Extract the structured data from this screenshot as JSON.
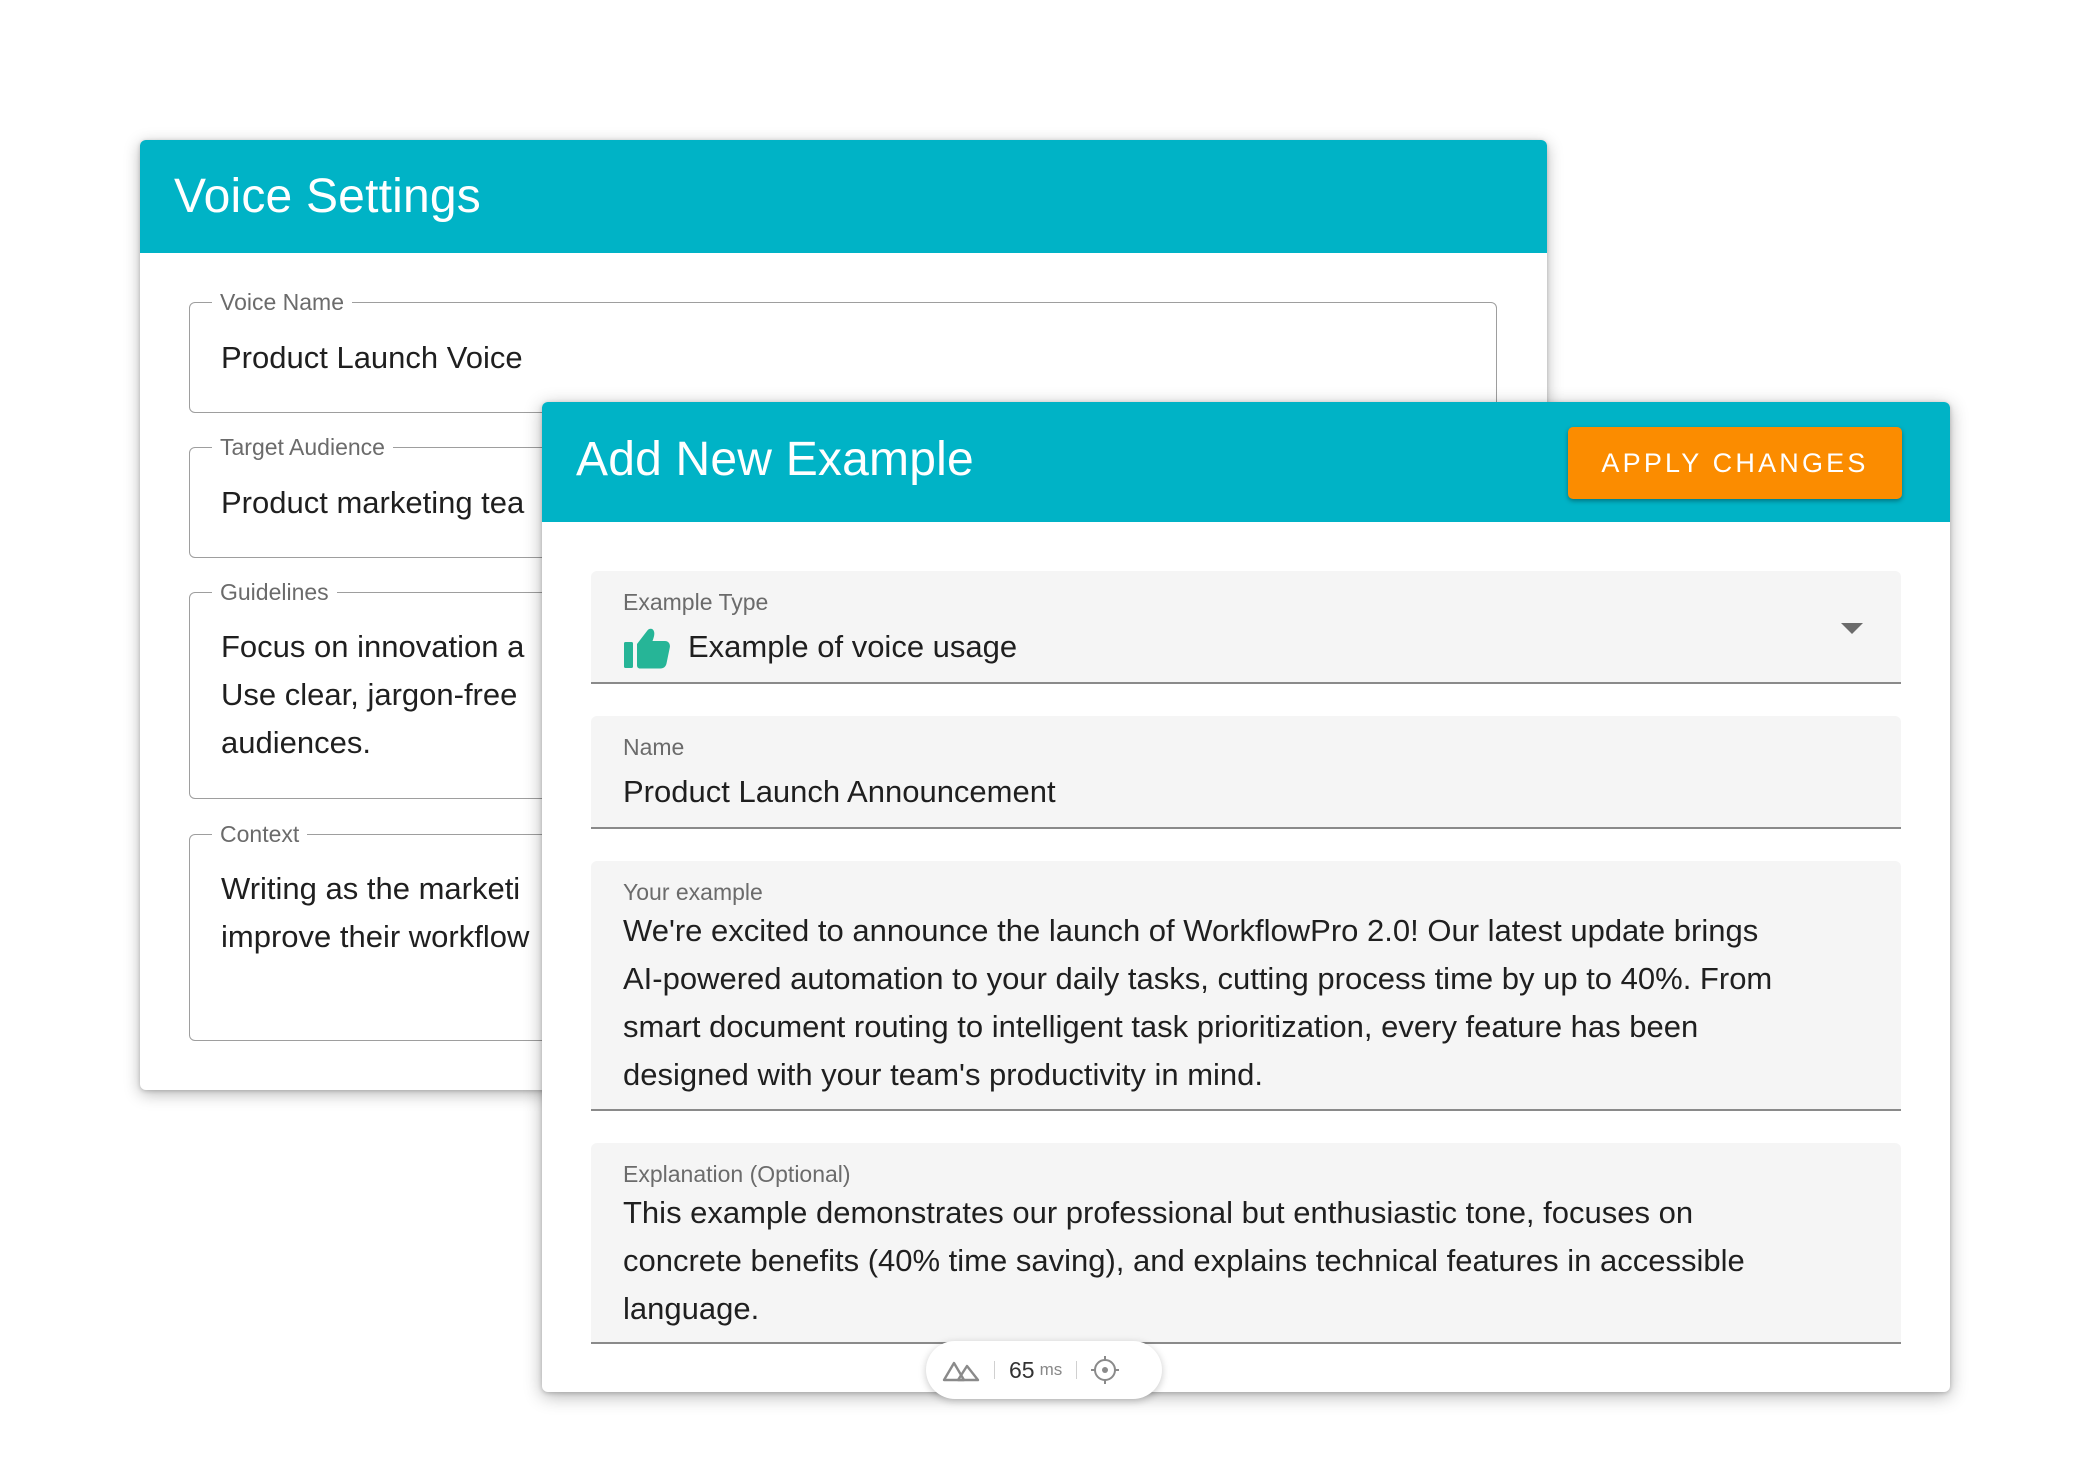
{
  "voice_settings": {
    "title": "Voice Settings",
    "fields": [
      {
        "label": "Voice Name",
        "value": "Product Launch Voice"
      },
      {
        "label": "Target Audience",
        "value": "Product marketing tea"
      },
      {
        "label": "Guidelines",
        "value": "Focus on innovation a\nUse clear, jargon-free\naudiences."
      },
      {
        "label": "Context",
        "value": "Writing as the marketi\nimprove their workflow"
      }
    ]
  },
  "add_example": {
    "title": "Add New Example",
    "apply_label": "APPLY CHANGES",
    "example_type": {
      "label": "Example Type",
      "value": "Example of voice usage",
      "icon": "thumbs-up-icon",
      "icon_color": "#26b597"
    },
    "name": {
      "label": "Name",
      "value": "Product Launch Announcement"
    },
    "your_example": {
      "label": "Your example",
      "lines": [
        "We're excited to announce the launch of WorkflowPro 2.0! Our latest update brings",
        "AI-powered automation to your daily tasks, cutting process time by up to 40%. From",
        "smart document routing to intelligent task prioritization, every feature has been",
        "designed with your team's productivity in mind."
      ]
    },
    "explanation": {
      "label": "Explanation (Optional)",
      "lines": [
        "This example demonstrates our professional but enthusiastic tone, focuses on",
        "concrete benefits (40% time saving), and explains technical features in accessible",
        "language."
      ]
    }
  },
  "perf_widget": {
    "value": "65",
    "unit": "ms"
  },
  "colors": {
    "header": "#00b3c6",
    "button": "#fb8c00",
    "icon": "#26b597"
  }
}
